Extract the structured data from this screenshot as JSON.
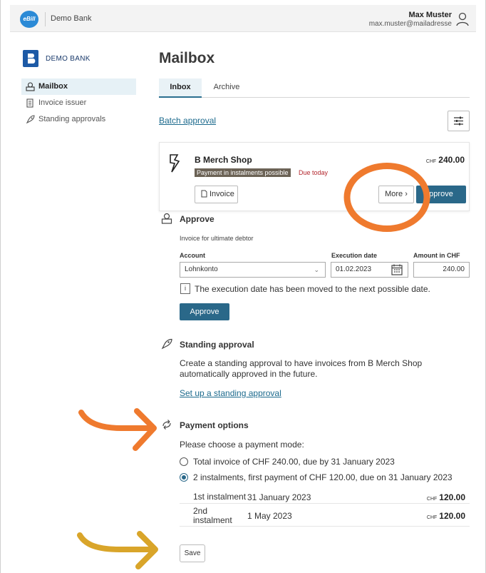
{
  "topbar": {
    "app_logo": "eBill",
    "bank_name": "Demo Bank",
    "user_name": "Max Muster",
    "user_email": "max.muster@mailadresse"
  },
  "sidebar": {
    "logo_text": "DEMO BANK",
    "items": [
      {
        "label": "Mailbox",
        "icon": "mailbox-icon",
        "active": true
      },
      {
        "label": "Invoice issuer",
        "icon": "document-icon",
        "active": false
      },
      {
        "label": "Standing approvals",
        "icon": "rocket-icon",
        "active": false
      }
    ]
  },
  "main": {
    "title": "Mailbox",
    "tabs": [
      {
        "label": "Inbox",
        "active": true
      },
      {
        "label": "Archive",
        "active": false
      }
    ],
    "batch_approval": "Batch approval"
  },
  "invoice_card": {
    "merchant": "B Merch Shop",
    "badge": "Payment in instalments possible",
    "due": "Due today",
    "currency": "CHF",
    "amount": "240.00",
    "invoice_button": "Invoice",
    "more_button": "More ›",
    "approve_button": "pprove"
  },
  "approve_section": {
    "title": "Approve",
    "subtitle": "Invoice for ultimate debtor",
    "account_label": "Account",
    "account_value": "Lohnkonto",
    "date_label": "Execution date",
    "date_value": "01.02.2023",
    "amount_label": "Amount in CHF",
    "amount_value": "240.00",
    "info_icon_text": "i",
    "info_text": "The execution date has been moved to the next possible date.",
    "approve_button": "Approve"
  },
  "standing_section": {
    "title": "Standing approval",
    "description": "Create a standing approval to have invoices from B Merch Shop automatically approved in the future.",
    "link": "Set up a standing approval"
  },
  "payment_section": {
    "title": "Payment options",
    "prompt": "Please choose a payment mode:",
    "options": [
      {
        "label": "Total invoice of CHF 240.00, due by 31 January 2023",
        "checked": false
      },
      {
        "label": "2 instalments, first payment of CHF 120.00, due on 31 January 2023",
        "checked": true
      }
    ],
    "instalments": [
      {
        "label": "1st instalment",
        "date": "31 January 2023",
        "currency": "CHF",
        "amount": "120.00"
      },
      {
        "label": "2nd instalment",
        "date": "1 May 2023",
        "currency": "CHF",
        "amount": "120.00"
      }
    ],
    "save_button": "Save"
  },
  "colors": {
    "primary": "#2a6889",
    "link": "#1c6a8d",
    "badge_bg": "#6b6255",
    "due_red": "#b3262d",
    "annotation_orange": "#ef7a2e",
    "annotation_yellow": "#d9a52a"
  }
}
